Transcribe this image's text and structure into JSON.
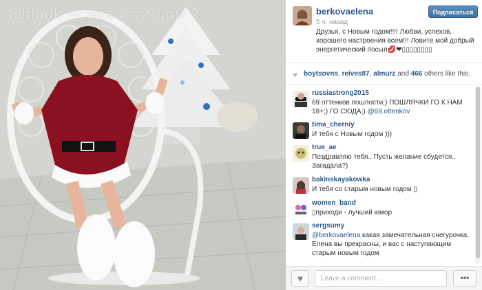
{
  "photo": {
    "watermark": "schlaak — новости дом 2"
  },
  "post": {
    "username": "berkovaelena",
    "subscribe_label": "Подписаться",
    "time": "5 ч. назад",
    "caption": "Друзья, с Новым годом!!!! Любви, успехов, хорошего настроения всем!!! Ловите мой добрый энергетический посыл💋❤▯▯▯▯▯▯▯▯"
  },
  "likes": {
    "user1": "boytsovns",
    "sep1": ", ",
    "user2": "reives87",
    "sep2": ", ",
    "user3": "almurz",
    "and": " and ",
    "count": "466",
    "suffix": " others like this."
  },
  "comments": [
    {
      "username": "russiastrong2015",
      "text": "69 оттенков пошлости;) ПОШЛЯЧКИ ГО К НАМ 18+;) ГО СЮДА;) ",
      "mention": "@69.ottenkov"
    },
    {
      "username": "tima_cherniy",
      "text": "И тебя с Новым годом )))"
    },
    {
      "username": "true_ae",
      "text": "Поздравляю тебя.. Пусть желание сбудется.. Загадала?)"
    },
    {
      "username": "bakinskayakowka",
      "text": "И тебя со старым новым годом ▯"
    },
    {
      "username": "women_band",
      "text": "▯приходи - лучший юмор"
    },
    {
      "username": "sergsumy",
      "mention": "@berkovaelena",
      "text": " какая замечательная снегурочка. Елена вы прекрасны, и вас с наступающим старым новым годом"
    }
  ],
  "footer": {
    "like_icon": "heart-icon",
    "input_placeholder": "Leave a comment...",
    "more_label": "•••"
  },
  "colors": {
    "username_blue": "#2a5a8a",
    "subscribe_button": "#4a7aaa",
    "panel_bg": "#ffffff"
  }
}
